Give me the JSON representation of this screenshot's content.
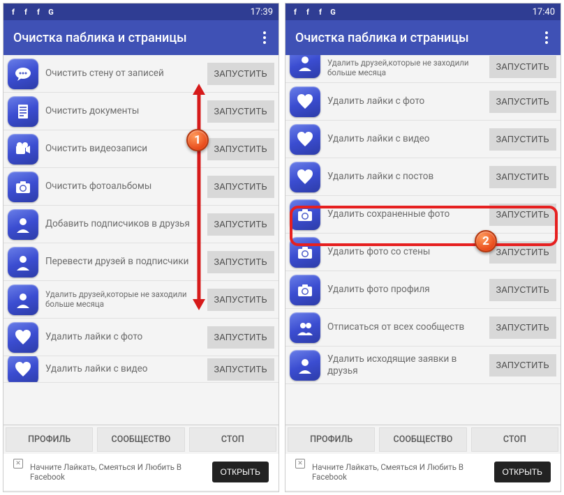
{
  "status": {
    "icons": [
      "f",
      "f",
      "f",
      "G"
    ],
    "time_left": "17:39",
    "time_right": "17:40"
  },
  "appbar": {
    "title": "Очистка паблика и страницы"
  },
  "run_label": "ЗАПУСТИТЬ",
  "left_rows": [
    "Очистить стену от записей",
    "Очистить документы",
    "Очистить видеозаписи",
    "Очистить фотоальбомы",
    "Добавить подписчиков в друзья",
    "Перевести друзей в подписчики",
    "Удалить друзей,которые не заходили больше месяца",
    "Удалить лайки с фото",
    "Удалить лайки с видео"
  ],
  "right_rows": [
    "Удалить друзей,которые не заходили больше месяца",
    "Удалить лайки с фото",
    "Удалить лайки с видео",
    "Удалить лайки с постов",
    "Удалить сохраненные фото",
    "Удалить фото со стены",
    "Удалить фото профиля",
    "Отписаться от всех сообществ",
    "Удалить исходящие заявки в друзья"
  ],
  "left_icons": [
    "speech",
    "doc",
    "video",
    "camera",
    "person",
    "person",
    "person",
    "heart",
    "heart"
  ],
  "right_icons": [
    "person",
    "heart",
    "heart",
    "heart",
    "camera",
    "camera",
    "camera",
    "people",
    "person"
  ],
  "tabs": {
    "profile": "ПРОФИЛЬ",
    "community": "СООБЩЕСТВО",
    "stop": "СТОП"
  },
  "ad": {
    "text": "Начните Лайкать, Смеяться И Любить В Facebook",
    "open": "ОТКРЫТЬ"
  }
}
